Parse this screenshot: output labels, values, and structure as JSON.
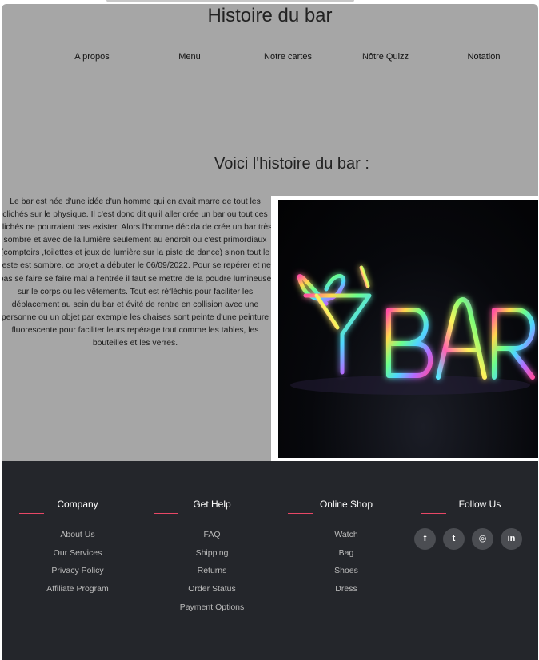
{
  "header": {
    "title": "Histoire du bar",
    "nav": [
      {
        "label": "A propos"
      },
      {
        "label": "Menu"
      },
      {
        "label": "Notre cartes"
      },
      {
        "label": "Nôtre Quizz"
      },
      {
        "label": "Notation"
      }
    ]
  },
  "main": {
    "section_title": "Voici l'histoire du bar :",
    "history_text": "Le bar est née d'une idée d'un homme qui en avait marre de tout les clichés sur le physique. Il c'est donc dit qu'il aller crée un bar ou tout ces clichés ne pourraient pas exister. Alors l'homme décida de crée un bar très sombre et avec de la lumière seulement au endroit ou c'est primordiaux (comptoirs ,toilettes et jeux de lumière sur la piste de dance) sinon tout le reste est sombre, ce projet a débuter le 06/09/2022. Pour se repérer et ne pas se faire se faire mal a l'entrée il faut se mettre de la poudre lumineuse sur le corps ou les vêtements. Tout est réfléchis pour faciliter les déplacement au sein du bar et évité de rentre en collision avec une personne ou un objet par exemple les chaises sont peinte d'une peinture fluorescente pour faciliter leurs repérage tout comme les tables, les bouteilles et les verres.",
    "photo_sign_text": "BAR"
  },
  "footer": {
    "accent_color": "#e84766",
    "columns": [
      {
        "heading": "Company",
        "links": [
          "About Us",
          "Our Services",
          "Privacy Policy",
          "Affiliate Program"
        ]
      },
      {
        "heading": "Get Help",
        "links": [
          "FAQ",
          "Shipping",
          "Returns",
          "Order Status",
          "Payment Options"
        ]
      },
      {
        "heading": "Online Shop",
        "links": [
          "Watch",
          "Bag",
          "Shoes",
          "Dress"
        ]
      },
      {
        "heading": "Follow Us",
        "socials": [
          {
            "icon": "facebook-icon",
            "glyph": "f"
          },
          {
            "icon": "twitter-icon",
            "glyph": "t"
          },
          {
            "icon": "instagram-icon",
            "glyph": "◎"
          },
          {
            "icon": "linkedin-icon",
            "glyph": "in"
          }
        ]
      }
    ]
  }
}
